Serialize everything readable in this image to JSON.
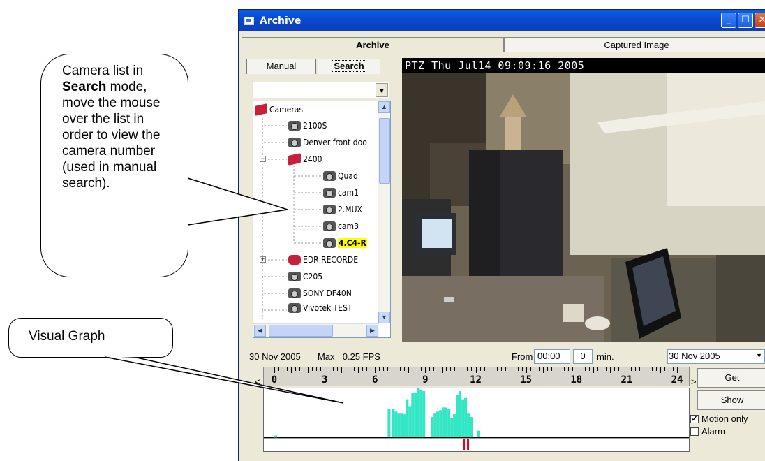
{
  "callouts": {
    "camera_list": {
      "line1": "Camera list in",
      "line2_bold": "Search",
      "line2_rest": " mode,",
      "lines": [
        "move the mouse",
        "over the list in",
        "order to view the",
        "camera number",
        "(used in manual",
        "search)."
      ]
    },
    "visual_graph": "Visual Graph"
  },
  "window": {
    "title": "Archive",
    "controls": [
      "minimize-icon",
      "maximize-icon",
      "close-icon"
    ]
  },
  "tabs": {
    "archive": "Archive",
    "captured": "Captured Image"
  },
  "left_tabs": {
    "manual": "Manual",
    "search": "Search"
  },
  "tree": {
    "root": "Cameras",
    "items": [
      "2100S",
      "Denver front doo",
      "2400",
      "Quad",
      "cam1",
      "2.MUX",
      "cam3",
      "4.C4-R",
      "EDR RECORDE",
      "C205",
      "SONY DF40N",
      "Vivotek TEST"
    ],
    "selected": "4.C4-R"
  },
  "video": {
    "osd": "PTZ  Thu Jul14  09:09:16  2005"
  },
  "graph_panel": {
    "date": "30 Nov 2005",
    "max": "Max= 0.25 FPS",
    "from_label": "From",
    "from_time": "00:00",
    "from_min": "0",
    "min_label": "min.",
    "date_select": "30 Nov 2005",
    "get": "Get",
    "show": "Show",
    "motion_only": "Motion only",
    "motion_only_checked": true,
    "alarm": "Alarm",
    "alarm_checked": false,
    "ruler_labels": [
      "0",
      "3",
      "6",
      "9",
      "12",
      "15",
      "18",
      "21",
      "24"
    ],
    "ruler_nav": [
      "<",
      ">"
    ]
  },
  "colors": {
    "motion": "#33e6c4",
    "alarm": "#e0001c",
    "selected_highlight": "#ffff00"
  }
}
